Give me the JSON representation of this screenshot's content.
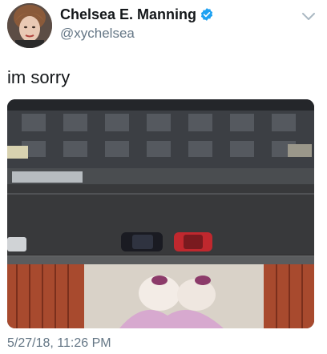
{
  "tweet": {
    "display_name": "Chelsea E. Manning",
    "handle": "@xychelsea",
    "text": "im sorry",
    "timestamp": "5/27/18, 11:26 PM"
  },
  "icons": {
    "verified": "verified-badge-icon",
    "menu": "chevron-down-icon"
  },
  "colors": {
    "name": "#14171a",
    "secondary": "#657786",
    "verified_blue": "#1da1f2"
  }
}
